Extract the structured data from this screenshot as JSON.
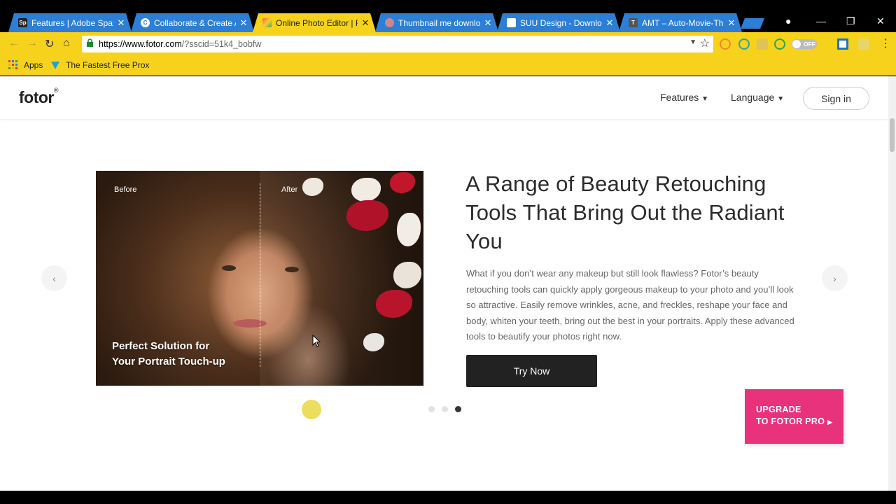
{
  "browser": {
    "tabs": [
      {
        "title": "Features | Adobe Spark",
        "favicon": "Sp"
      },
      {
        "title": "Collaborate & Create A",
        "favicon": "C"
      },
      {
        "title": "Online Photo Editor | Fo",
        "favicon": ""
      },
      {
        "title": "Thumbnail me downloa",
        "favicon": ""
      },
      {
        "title": "SUU Design - Downloa",
        "favicon": ""
      },
      {
        "title": "AMT – Auto-Movie-Thu",
        "favicon": "T"
      }
    ],
    "url_host": "https://www.fotor.com",
    "url_rest": "/?sscid=51k4_bobfw",
    "toggle_label": "OFF",
    "bookmarks": [
      {
        "label": "Apps",
        "icon": "apps-grid-icon"
      },
      {
        "label": "The Fastest Free Prox",
        "icon": "vpn-icon"
      }
    ]
  },
  "site": {
    "logo": "fotor",
    "logo_mark": "®",
    "nav": {
      "features": "Features",
      "language": "Language",
      "signin": "Sign in"
    }
  },
  "slide": {
    "before_label": "Before",
    "after_label": "After",
    "caption_line1": "Perfect Solution for",
    "caption_line2": "Your Portrait Touch-up",
    "headline": "A Range of Beauty Retouching Tools That Bring Out the Radiant You",
    "description": "What if you don’t wear any makeup but still look flawless? Fotor’s beauty retouching tools can quickly apply gorgeous makeup to your photo and you’ll look so attractive. Easily remove wrinkles, acne, and freckles, reshape your face and body, whiten your teeth, bring out the best in your portraits. Apply these advanced tools to beautify your photos right now.",
    "cta": "Try Now",
    "dots": 3,
    "active_dot": 3
  },
  "promo": {
    "line1": "UPGRADE",
    "line2": "TO FOTOR PRO"
  },
  "colors": {
    "chrome_tab": "#2d7fd6",
    "chrome_active": "#f6d21c",
    "promo": "#e8327c",
    "cta": "#222222"
  }
}
